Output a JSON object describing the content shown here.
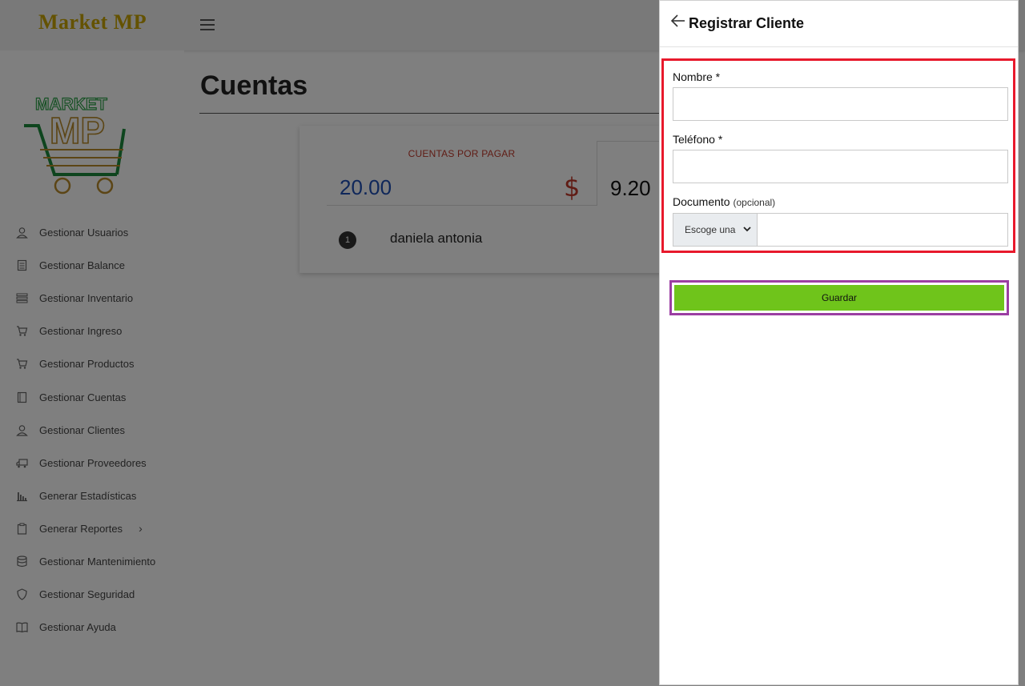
{
  "app": {
    "brand": "Market MP"
  },
  "sidebar": {
    "logo_alt": "MARKET MP",
    "items": [
      {
        "label": "Gestionar Usuarios",
        "icon": "user-icon"
      },
      {
        "label": "Gestionar Balance",
        "icon": "ledger-icon"
      },
      {
        "label": "Gestionar Inventario",
        "icon": "list-icon"
      },
      {
        "label": "Gestionar Ingreso",
        "icon": "cart-icon"
      },
      {
        "label": "Gestionar Productos",
        "icon": "cart-icon"
      },
      {
        "label": "Gestionar Cuentas",
        "icon": "book-icon"
      },
      {
        "label": "Gestionar Clientes",
        "icon": "user-icon"
      },
      {
        "label": "Gestionar Proveedores",
        "icon": "truck-icon"
      },
      {
        "label": "Generar Estadísticas",
        "icon": "chart-icon"
      },
      {
        "label": "Generar Reportes",
        "icon": "clipboard-icon",
        "has_submenu": true
      },
      {
        "label": "Gestionar Mantenimiento",
        "icon": "database-icon"
      },
      {
        "label": "Gestionar Seguridad",
        "icon": "shield-icon"
      },
      {
        "label": "Gestionar Ayuda",
        "icon": "open-book-icon"
      }
    ]
  },
  "main": {
    "title": "Cuentas",
    "card": {
      "stat1_label": "CUENTAS POR PAGAR",
      "stat1_value": "20.00",
      "stat1_symbol": "$",
      "stat2_value": "9.20",
      "list": [
        {
          "rank": "1",
          "name": "daniela antonia"
        }
      ]
    }
  },
  "drawer": {
    "title": "Registrar Cliente",
    "fields": {
      "nombre_label": "Nombre *",
      "nombre_value": "",
      "telefono_label": "Teléfono *",
      "telefono_value": "",
      "documento_label": "Documento",
      "documento_optional": "(opcional)",
      "documento_select": "Escoge una",
      "documento_value": ""
    },
    "save_label": "Guardar"
  },
  "colors": {
    "brand": "#c9a400",
    "save_button": "#6fc41b",
    "highlight_form": "#e8192c",
    "highlight_button": "#9b3ea2",
    "stat_value": "#1f4fb5",
    "stat_label": "#c0392b"
  }
}
